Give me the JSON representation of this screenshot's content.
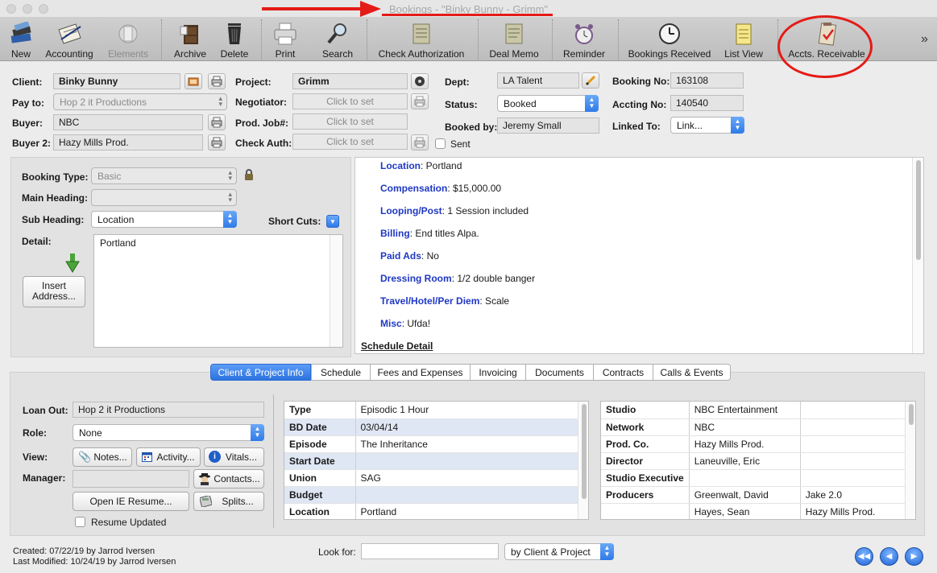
{
  "window": {
    "title": "Bookings - \"Binky Bunny - Grimm\""
  },
  "toolbar": {
    "items": [
      {
        "label": "New",
        "icon": "books-icon",
        "enabled": true
      },
      {
        "label": "Accounting",
        "icon": "ledger-icon",
        "enabled": true
      },
      {
        "label": "Elements",
        "icon": "elements-icon",
        "enabled": false
      },
      {
        "label": "Archive",
        "icon": "archive-cabinet-icon",
        "enabled": true
      },
      {
        "label": "Delete",
        "icon": "trash-icon",
        "enabled": true
      },
      {
        "label": "Print",
        "icon": "printer-icon",
        "enabled": true
      },
      {
        "label": "Search",
        "icon": "magnifier-icon",
        "enabled": true
      },
      {
        "label": "Check Authorization",
        "icon": "checkbook-icon",
        "enabled": true
      },
      {
        "label": "Deal Memo",
        "icon": "memo-icon",
        "enabled": true
      },
      {
        "label": "Reminder",
        "icon": "alarm-clock-icon",
        "enabled": true
      },
      {
        "label": "Bookings Received",
        "icon": "clock-icon",
        "enabled": true
      },
      {
        "label": "List View",
        "icon": "notepad-icon",
        "enabled": true
      },
      {
        "label": "Accts. Receivable",
        "icon": "clipboard-check-icon",
        "enabled": true
      }
    ],
    "overflow": "»"
  },
  "form": {
    "client_label": "Client:",
    "client": "Binky Bunny",
    "payto_label": "Pay to:",
    "payto": "Hop 2 it Productions",
    "buyer_label": "Buyer:",
    "buyer": "NBC",
    "buyer2_label": "Buyer 2:",
    "buyer2": "Hazy Mills Prod.",
    "project_label": "Project:",
    "project": "Grimm",
    "negotiator_label": "Negotiator:",
    "negotiator_placeholder": "Click to set",
    "prodjob_label": "Prod. Job#:",
    "prodjob_placeholder": "Click to set",
    "checkauth_label": "Check Auth:",
    "checkauth_placeholder": "Click to set",
    "dept_label": "Dept:",
    "dept": "LA Talent",
    "status_label": "Status:",
    "status": "Booked",
    "bookedby_label": "Booked by:",
    "bookedby": "Jeremy Small",
    "sent_label": "Sent",
    "bookingno_label": "Booking No:",
    "bookingno": "163108",
    "acctingno_label": "Accting No:",
    "acctingno": "140540",
    "linkedto_label": "Linked To:",
    "linkedto": "Link..."
  },
  "booking": {
    "type_label": "Booking Type:",
    "type": "Basic",
    "mainheading_label": "Main Heading:",
    "mainheading": "",
    "subheading_label": "Sub Heading:",
    "subheading": "Location",
    "shortcuts_label": "Short Cuts:",
    "detail_label": "Detail:",
    "detail": "Portland",
    "insert_address": "Insert Address..."
  },
  "detail_lines": [
    {
      "key": "Location",
      "value": ": Portland"
    },
    {
      "key": "Compensation",
      "value": ": $15,000.00"
    },
    {
      "key": "Looping/Post",
      "value": ": 1 Session included"
    },
    {
      "key": "Billing",
      "value": ": End titles Alpa."
    },
    {
      "key": "Paid Ads",
      "value": ": No"
    },
    {
      "key": "Dressing Room",
      "value": ": 1/2 double banger"
    },
    {
      "key": "Travel/Hotel/Per Diem",
      "value": ": Scale"
    },
    {
      "key": "Misc",
      "value": ": Ufda!"
    }
  ],
  "schedule_detail_heading": "Schedule Detail",
  "tabs": [
    {
      "label": "Client & Project Info",
      "active": true
    },
    {
      "label": "Schedule",
      "active": false
    },
    {
      "label": "Fees and Expenses",
      "active": false
    },
    {
      "label": "Invoicing",
      "active": false
    },
    {
      "label": "Documents",
      "active": false
    },
    {
      "label": "Contracts",
      "active": false
    },
    {
      "label": "Calls & Events",
      "active": false
    }
  ],
  "lower": {
    "loanout_label": "Loan Out:",
    "loanout": "Hop 2 it Productions",
    "role_label": "Role:",
    "role": "None",
    "view_label": "View:",
    "notes_btn": "Notes...",
    "activity_btn": "Activity...",
    "vitals_btn": "Vitals...",
    "manager_label": "Manager:",
    "manager": "",
    "contacts_btn": "Contacts...",
    "openie_btn": "Open IE Resume...",
    "splits_btn": "Splits...",
    "resume_updated_label": "Resume Updated"
  },
  "project_table": [
    {
      "key": "Type",
      "value": "Episodic 1 Hour"
    },
    {
      "key": "BD Date",
      "value": "03/04/14"
    },
    {
      "key": "Episode",
      "value": "The Inheritance"
    },
    {
      "key": "Start Date",
      "value": ""
    },
    {
      "key": "Union",
      "value": "SAG"
    },
    {
      "key": "Budget",
      "value": ""
    },
    {
      "key": "Location",
      "value": "Portland"
    }
  ],
  "studio_table": [
    {
      "key": "Studio",
      "v1": "NBC Entertainment",
      "v2": ""
    },
    {
      "key": "Network",
      "v1": "NBC",
      "v2": ""
    },
    {
      "key": "Prod. Co.",
      "v1": "Hazy Mills Prod.",
      "v2": ""
    },
    {
      "key": "Director",
      "v1": "Laneuville, Eric",
      "v2": ""
    },
    {
      "key": "Studio Executive",
      "v1": "",
      "v2": ""
    },
    {
      "key": "Producers",
      "v1": "Greenwalt, David",
      "v2": "Jake 2.0"
    },
    {
      "key": "",
      "v1": "Hayes, Sean",
      "v2": "Hazy Mills Prod."
    }
  ],
  "footer": {
    "created": "Created: 07/22/19 by Jarrod Iversen",
    "modified": "Last Modified: 10/24/19 by Jarrod Iversen",
    "lookfor_label": "Look for:",
    "lookfor_value": "",
    "lookby": "by Client & Project"
  },
  "colors": {
    "annotation_red": "#e41b17",
    "accent_blue": "#2f7ae8",
    "detail_key_blue": "#1f38c4"
  }
}
